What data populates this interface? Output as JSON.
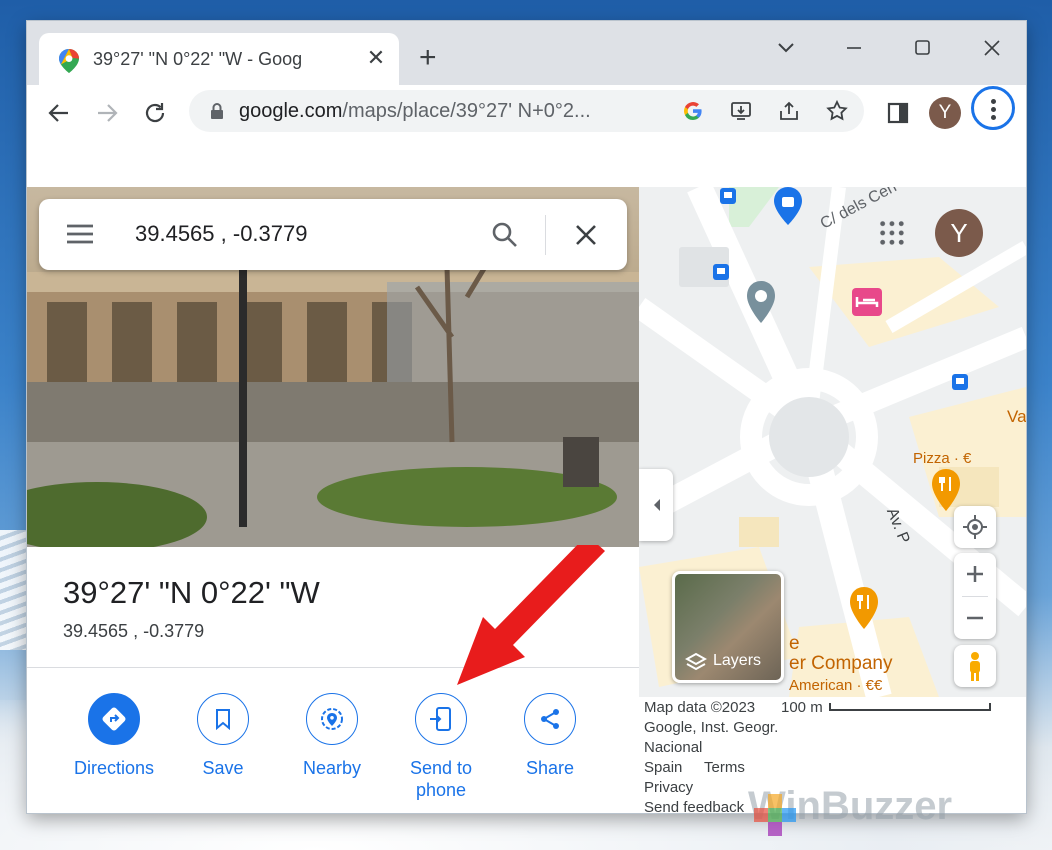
{
  "browser": {
    "tab_title": "39°27'  \"N 0°22'  \"W - Goog",
    "new_tab": "+",
    "url_host": "google.com",
    "url_path": "/maps/place/39°27'  N+0°2...",
    "profile_initial": "Y"
  },
  "maps": {
    "search_query": "39.4565  , -0.3779",
    "place_title": "39°27'  \"N 0°22'  \"W",
    "place_coords": "39.4565  , -0.3779",
    "actions": [
      {
        "label": "Directions"
      },
      {
        "label": "Save"
      },
      {
        "label": "Nearby"
      },
      {
        "label": "Send to phone"
      },
      {
        "label": "Share"
      }
    ],
    "map_labels": {
      "street": "C/ dels Cen",
      "pizza": "Pizza · €",
      "company": "er Company",
      "company_prefix": "e",
      "american": "American · €€",
      "avenue": "Av. P",
      "va": "Va"
    },
    "layers_label": "Layers",
    "profile_initial": "Y",
    "attribution": {
      "line1": "Map data ©2023",
      "line2": "Google, Inst. Geogr.",
      "line3": "Nacional",
      "spain": "Spain",
      "terms": "Terms",
      "privacy": "Privacy",
      "feedback": "Send feedback",
      "scale": "100 m"
    }
  },
  "watermark": "WinBuzzer",
  "colors": {
    "accent": "#1a73e8",
    "arrow": "#e81c1c",
    "hotel": "#e8488a",
    "restaurant": "#f29900"
  }
}
